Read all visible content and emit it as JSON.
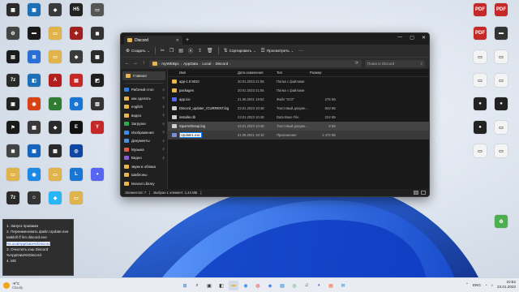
{
  "desktop": {
    "left_icons": [
      {
        "label": "",
        "color": "#2b2b2b",
        "glyph": "▦",
        "col": 0,
        "row": 0
      },
      {
        "label": "",
        "color": "#1d6fb8",
        "glyph": "▣",
        "col": 1,
        "row": 0
      },
      {
        "label": "",
        "color": "#3a3a3a",
        "glyph": "◆",
        "col": 2,
        "row": 0
      },
      {
        "label": "",
        "color": "#222222",
        "glyph": "H5",
        "col": 3,
        "row": 0
      },
      {
        "label": "",
        "color": "#555555",
        "glyph": "▭",
        "col": 4,
        "row": 0
      },
      {
        "label": "",
        "color": "#444444",
        "glyph": "⚙",
        "col": 0,
        "row": 1
      },
      {
        "label": "",
        "color": "#1a1a1a",
        "glyph": "▬",
        "col": 1,
        "row": 1
      },
      {
        "label": "",
        "color": "#e0b44a",
        "glyph": "▭",
        "col": 2,
        "row": 1
      },
      {
        "label": "",
        "color": "#a02020",
        "glyph": "✚",
        "col": 3,
        "row": 1
      },
      {
        "label": "",
        "color": "#333333",
        "glyph": "◼",
        "col": 4,
        "row": 1
      },
      {
        "label": "",
        "color": "#1c1c1c",
        "glyph": "▤",
        "col": 0,
        "row": 2
      },
      {
        "label": "",
        "color": "#2a6fd6",
        "glyph": "⊞",
        "col": 1,
        "row": 2
      },
      {
        "label": "",
        "color": "#e0b44a",
        "glyph": "▭",
        "col": 2,
        "row": 2
      },
      {
        "label": "",
        "color": "#3a3a3a",
        "glyph": "◆",
        "col": 3,
        "row": 2
      },
      {
        "label": "",
        "color": "#2b2b2b",
        "glyph": "▦",
        "col": 4,
        "row": 2
      },
      {
        "label": "",
        "color": "#2a2a2a",
        "glyph": "7z",
        "col": 0,
        "row": 3
      },
      {
        "label": "",
        "color": "#1d6fb8",
        "glyph": "◧",
        "col": 1,
        "row": 3
      },
      {
        "label": "",
        "color": "#b31e1e",
        "glyph": "A",
        "col": 2,
        "row": 3
      },
      {
        "label": "",
        "color": "#c62828",
        "glyph": "▤",
        "col": 3,
        "row": 3
      },
      {
        "label": "",
        "color": "#1f1f1f",
        "glyph": "◩",
        "col": 4,
        "row": 3
      },
      {
        "label": "",
        "color": "#222222",
        "glyph": "▣",
        "col": 0,
        "row": 4
      },
      {
        "label": "",
        "color": "#d84315",
        "glyph": "◉",
        "col": 1,
        "row": 4
      },
      {
        "label": "",
        "color": "#2e7d32",
        "glyph": "▲",
        "col": 2,
        "row": 4
      },
      {
        "label": "",
        "color": "#1976d2",
        "glyph": "◍",
        "col": 3,
        "row": 4
      },
      {
        "label": "",
        "color": "#333333",
        "glyph": "▥",
        "col": 4,
        "row": 4
      },
      {
        "label": "",
        "color": "#1a1a1a",
        "glyph": "⚑",
        "col": 0,
        "row": 5
      },
      {
        "label": "",
        "color": "#3a3a3a",
        "glyph": "▦",
        "col": 1,
        "row": 5
      },
      {
        "label": "",
        "color": "#2b2b2b",
        "glyph": "◆",
        "col": 2,
        "row": 5
      },
      {
        "label": "",
        "color": "#111111",
        "glyph": "E",
        "col": 3,
        "row": 5
      },
      {
        "label": "",
        "color": "#c62828",
        "glyph": "Y",
        "col": 4,
        "row": 5
      },
      {
        "label": "",
        "color": "#444444",
        "glyph": "◼",
        "col": 0,
        "row": 6
      },
      {
        "label": "",
        "color": "#1565c0",
        "glyph": "▣",
        "col": 1,
        "row": 6
      },
      {
        "label": "",
        "color": "#2b2b2b",
        "glyph": "▦",
        "col": 2,
        "row": 6
      },
      {
        "label": "",
        "color": "#0d47a1",
        "glyph": "◎",
        "col": 3,
        "row": 6
      },
      {
        "label": "",
        "color": "#e0b44a",
        "glyph": "▭",
        "col": 0,
        "row": 7
      },
      {
        "label": "",
        "color": "#1e88e5",
        "glyph": "◉",
        "col": 1,
        "row": 7
      },
      {
        "label": "",
        "color": "#e0b44a",
        "glyph": "▭",
        "col": 2,
        "row": 7
      },
      {
        "label": "",
        "color": "#1976d2",
        "glyph": "L",
        "col": 3,
        "row": 7
      },
      {
        "label": "",
        "color": "#5865f2",
        "glyph": "◕",
        "col": 4,
        "row": 7
      },
      {
        "label": "",
        "color": "#2a2a2a",
        "glyph": "7z",
        "col": 0,
        "row": 8
      },
      {
        "label": "",
        "color": "#333333",
        "glyph": "☺",
        "col": 1,
        "row": 8
      },
      {
        "label": "",
        "color": "#29b6f6",
        "glyph": "◆",
        "col": 2,
        "row": 8
      },
      {
        "label": "",
        "color": "#e0b44a",
        "glyph": "▭",
        "col": 3,
        "row": 8
      }
    ],
    "right_icons": [
      {
        "label": "",
        "color": "#c62828",
        "glyph": "PDF",
        "col": 0,
        "row": 0
      },
      {
        "label": "",
        "color": "#c62828",
        "glyph": "PDF",
        "col": 1,
        "row": 0
      },
      {
        "label": "",
        "color": "#333333",
        "glyph": "▬",
        "col": 1,
        "row": 1
      },
      {
        "label": "",
        "color": "#c62828",
        "glyph": "PDF",
        "col": 0,
        "row": 1
      },
      {
        "label": "",
        "color": "#f4f4f4",
        "glyph": "▭",
        "col": 0,
        "row": 2
      },
      {
        "label": "",
        "color": "#f4f4f4",
        "glyph": "▭",
        "col": 1,
        "row": 2
      },
      {
        "label": "",
        "color": "#f4f4f4",
        "glyph": "▭",
        "col": 0,
        "row": 3
      },
      {
        "label": "",
        "color": "#f4f4f4",
        "glyph": "▭",
        "col": 1,
        "row": 3
      },
      {
        "label": "",
        "color": "#222222",
        "glyph": "●",
        "col": 0,
        "row": 4
      },
      {
        "label": "",
        "color": "#222222",
        "glyph": "●",
        "col": 1,
        "row": 4
      },
      {
        "label": "",
        "color": "#222222",
        "glyph": "●",
        "col": 0,
        "row": 5
      },
      {
        "label": "",
        "color": "#f4f4f4",
        "glyph": "▭",
        "col": 1,
        "row": 5
      },
      {
        "label": "",
        "color": "#f4f4f4",
        "glyph": "▭",
        "col": 0,
        "row": 6
      },
      {
        "label": "",
        "color": "#f4f4f4",
        "glyph": "▭",
        "col": 1,
        "row": 6
      },
      {
        "label": "",
        "color": "#4caf50",
        "glyph": "♻",
        "col": 1,
        "row": 9
      }
    ]
  },
  "explorer": {
    "tab_title": "Discord",
    "window_controls": [
      "—",
      "▢",
      "✕"
    ],
    "command_bar": {
      "create": "Создать",
      "sort": "Сортировать",
      "view": "Просмотреть"
    },
    "address": {
      "crumbs": [
        "myWEBpc",
        "AppData",
        "Local",
        "Discord"
      ],
      "search_placeholder": "Поиск в: Discord"
    },
    "sidebar": [
      {
        "label": "Главная",
        "color": "#e8b64c",
        "pinned": false
      },
      {
        "label": "Рабочий стол",
        "color": "#2f7de1",
        "pinned": true
      },
      {
        "label": "как сделать",
        "color": "#e8b64c",
        "pinned": true
      },
      {
        "label": "english",
        "color": "#e8b64c",
        "pinned": true
      },
      {
        "label": "видео",
        "color": "#e8b64c",
        "pinned": true
      },
      {
        "label": "Загрузки",
        "color": "#2eaa4c",
        "pinned": true
      },
      {
        "label": "Изображения",
        "color": "#3c8fe6",
        "pinned": true
      },
      {
        "label": "Документы",
        "color": "#4a8fd9",
        "pinned": true
      },
      {
        "label": "Музыка",
        "color": "#e05c3c",
        "pinned": true
      },
      {
        "label": "Видео",
        "color": "#8b5cd6",
        "pinned": true
      },
      {
        "label": "звуки и облака",
        "color": "#e8b64c",
        "pinned": false
      },
      {
        "label": "Шаблоны",
        "color": "#e8b64c",
        "pinned": false
      },
      {
        "label": "Movavi Library",
        "color": "#e8b64c",
        "pinned": false
      }
    ],
    "columns": {
      "name": "Имя",
      "date": "Дата изменения",
      "type": "Тип",
      "size": "Размер"
    },
    "files": [
      {
        "name": "app-1.0.9010",
        "date": "20.01.2023 21:55",
        "type": "Папка с файлами",
        "size": "",
        "icon_color": "#e8b64c",
        "state": "normal"
      },
      {
        "name": "packages",
        "date": "20.01.2023 21:55",
        "type": "Папка с файлами",
        "size": "",
        "icon_color": "#e8b64c",
        "state": "normal"
      },
      {
        "name": "app.ico",
        "date": "21.05.2021 19:52",
        "type": "Файл \"ICO\"",
        "size": "276 КБ",
        "icon_color": "#5865f2",
        "state": "normal"
      },
      {
        "name": "Discord_updater_rCURRENT.log",
        "date": "23.01.2023 10:48",
        "type": "Текстовый докуме...",
        "size": "843 КБ",
        "icon_color": "#d0d0d0",
        "state": "normal"
      },
      {
        "name": "installer.db",
        "date": "23.01.2023 10:48",
        "type": "Data Base File",
        "size": "224 КБ",
        "icon_color": "#d0d0d0",
        "state": "normal"
      },
      {
        "name": "SquirrelSetup.log",
        "date": "23.01.2023 10:48",
        "type": "Текстовый докуме...",
        "size": "8 КБ",
        "icon_color": "#d0d0d0",
        "state": "selected"
      },
      {
        "name": "Update1.exe",
        "date": "21.05.2021 18:10",
        "type": "Приложение",
        "size": "1 473 КБ",
        "icon_color": "#7a8ee0",
        "state": "renaming"
      }
    ],
    "status": {
      "items": "Элементов: 7",
      "selected": "Выбран 1 элемент: 1,44 МБ"
    }
  },
  "notes": [
    {
      "text": "1. Запуск правами",
      "highlight": false
    },
    {
      "text": "2. Переименовать файл Update.exe",
      "highlight": false
    },
    {
      "text": "taskkill /f /im discord.exe",
      "highlight": false
    },
    {
      "text": "%LocalAppData%\\Discord",
      "highlight": true
    },
    {
      "text": "3. Очистить кэш Discord",
      "highlight": false
    },
    {
      "text": "%AppData%\\Discord",
      "highlight": false
    },
    {
      "text": "4. МS",
      "highlight": false
    }
  ],
  "taskbar": {
    "weather_temp": "-9°C",
    "weather_desc": "Cloudy",
    "apps": [
      {
        "glyph": "⊞",
        "color": "#1e6fd9",
        "active": false
      },
      {
        "glyph": "⌕",
        "color": "#333333",
        "active": false
      },
      {
        "glyph": "▣",
        "color": "#333333",
        "active": false
      },
      {
        "glyph": "◧",
        "color": "#3a3a3a",
        "active": false
      },
      {
        "glyph": "▬",
        "color": "#e8b64c",
        "active": true
      },
      {
        "glyph": "◉",
        "color": "#1e88e5",
        "active": false
      },
      {
        "glyph": "◍",
        "color": "#e53935",
        "active": false
      },
      {
        "glyph": "◆",
        "color": "#4285f4",
        "active": false
      },
      {
        "glyph": "▤",
        "color": "#0078d4",
        "active": false
      },
      {
        "glyph": "◎",
        "color": "#43a047",
        "active": false
      },
      {
        "glyph": "♫",
        "color": "#333333",
        "active": false
      },
      {
        "glyph": "◕",
        "color": "#5865f2",
        "active": false
      },
      {
        "glyph": "▦",
        "color": "#ff7043",
        "active": false
      },
      {
        "glyph": "✉",
        "color": "#0288d1",
        "active": false
      }
    ],
    "lang": "ENG",
    "time": "10:52",
    "date": "23.01.2023"
  }
}
